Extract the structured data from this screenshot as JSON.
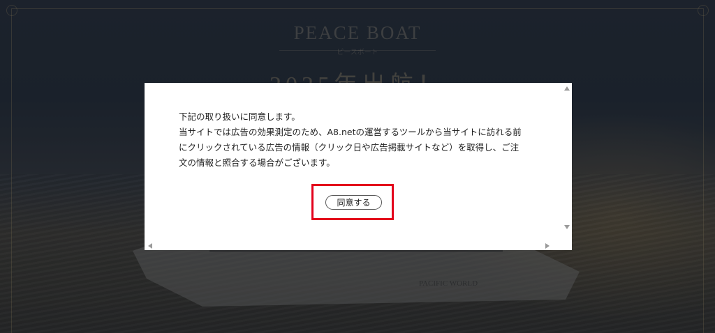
{
  "background": {
    "brand": "PEACE BOAT",
    "brand_sub": "ピースボート",
    "headline": "2025年出航！",
    "ship_name": "PACIFIC WORLD"
  },
  "dialog": {
    "lines": [
      "下記の取り扱いに同意します。",
      "当サイトでは広告の効果測定のため、A8.netの運営するツールから当サイトに訪れる前",
      "にクリックされている広告の情報（クリック日や広告掲載サイトなど）を取得し、ご注",
      "文の情報と照合する場合がございます。"
    ],
    "agree_label": "同意する",
    "highlight_color": "#e3001b"
  }
}
